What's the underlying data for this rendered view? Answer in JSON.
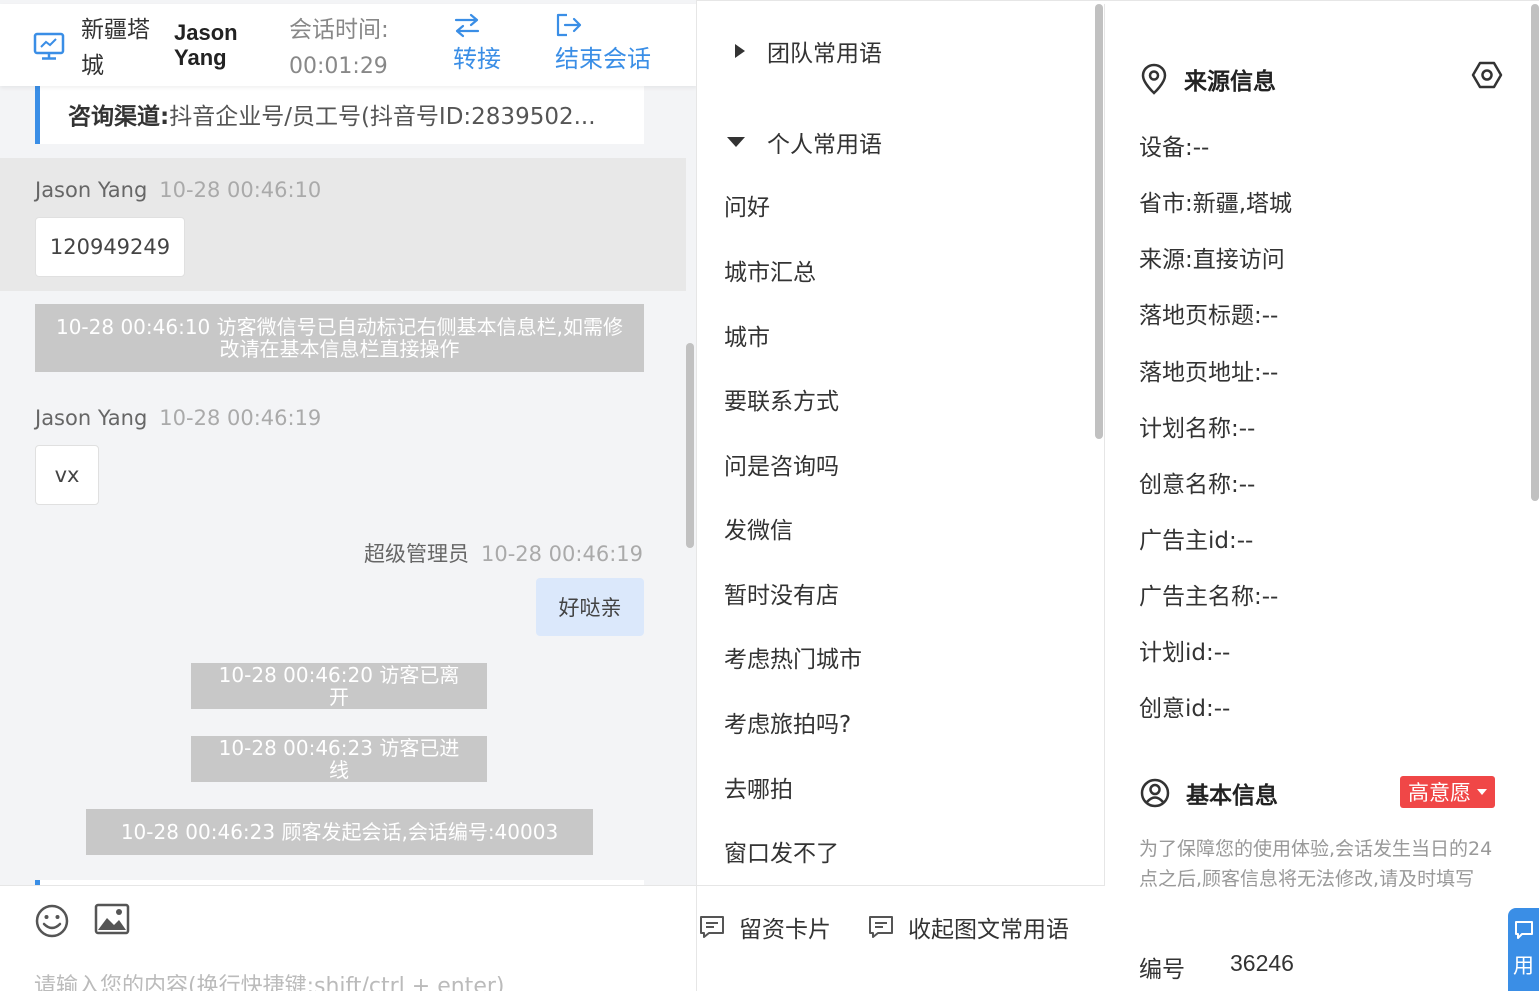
{
  "header": {
    "visitor_location": "新疆塔城",
    "visitor_name": "Jason Yang",
    "session_time_label": "会话时间:",
    "session_time_value": "00:01:29",
    "transfer_label": "转接",
    "end_label": "结束会话"
  },
  "channel": {
    "label": "咨询渠道:",
    "value": "抖音企业号/员工号(抖音号ID:2839502..."
  },
  "messages": [
    {
      "sender": "Jason Yang",
      "time": "10-28 00:46:10",
      "text": "120949249"
    },
    {
      "system": "10-28 00:46:10 访客微信号已自动标记右侧基本信息栏,如需修改请在基本信息栏直接操作"
    },
    {
      "sender": "Jason Yang",
      "time": "10-28 00:46:19",
      "text": "vx"
    },
    {
      "sender": "超级管理员",
      "time": "10-28 00:46:19",
      "text": "好哒亲"
    },
    {
      "system": "10-28 00:46:20 访客已离开"
    },
    {
      "system": "10-28 00:46:23 访客已进线"
    },
    {
      "system": "10-28 00:46:23 顾客发起会话,会话编号:40003"
    }
  ],
  "input": {
    "placeholder": "请输入您的内容(换行快捷键:shift/ctrl + enter)"
  },
  "phrases": {
    "team_group": "团队常用语",
    "personal_group": "个人常用语",
    "items": [
      "问好",
      "城市汇总",
      "城市",
      "要联系方式",
      "问是咨询吗",
      "发微信",
      "暂时没有店",
      "考虑热门城市",
      "考虑旅拍吗?",
      "去哪拍",
      "窗口发不了"
    ],
    "leave_card": "留资卡片",
    "collapse": "收起图文常用语"
  },
  "source_info": {
    "title": "来源信息",
    "rows": [
      "设备:--",
      "省市:新疆,塔城",
      "来源:直接访问",
      "落地页标题:--",
      "落地页地址:--",
      "计划名称:--",
      "创意名称:--",
      "广告主id:--",
      "广告主名称:--",
      "计划id:--",
      "创意id:--"
    ]
  },
  "basic_info": {
    "title": "基本信息",
    "intent": "高意愿",
    "notice": "为了保障您的使用体验,会话发生当日的24点之后,顾客信息将无法修改,请及时填写",
    "id_label": "编号",
    "id_value": "36246"
  },
  "float_tab": {
    "label": "用"
  },
  "colors": {
    "accent": "#3a8ee6",
    "intent_badge": "#f04747",
    "system_msg": "#c8c8c8",
    "my_bubble": "#dbe8fb"
  }
}
